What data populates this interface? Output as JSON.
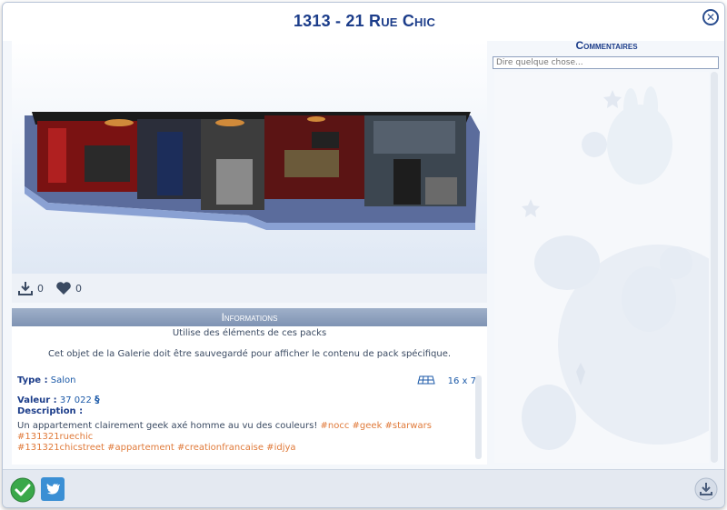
{
  "window": {
    "title": "1313 - 21 Rue Chic"
  },
  "stats": {
    "downloads": "0",
    "favorites": "0"
  },
  "info": {
    "header": "Informations",
    "packs_line": "Utilise des éléments de ces packs",
    "gallery_note": "Cet objet de la Galerie doit être sauvegardé pour afficher le contenu de pack spécifique.",
    "type_label": "Type :",
    "type_value": "Salon",
    "value_label": "Valeur :",
    "value_amount": "37 022",
    "currency_symbol": "§",
    "description_label": "Description :",
    "size": "16 x 7",
    "description_text": "Un appartement clairement geek axé homme au vu des couleurs!",
    "hashtags_line1": "#nocc #geek #starwars #131321ruechic",
    "hashtags_line2": "#131321chicstreet #appartement #creationfrancaise #idjya"
  },
  "comments": {
    "title": "Commentaires",
    "placeholder": "Dire quelque chose..."
  },
  "icons": {
    "close": "close-icon",
    "download": "download-icon",
    "heart": "heart-icon",
    "size": "grid-icon",
    "confirm": "checkmark-icon",
    "twitter": "twitter-icon",
    "save": "save-download-icon"
  },
  "colors": {
    "accent": "#1c3d8a",
    "hashtag": "#e07a3a",
    "info_header": "#8a9dbc",
    "confirm_green": "#3aa84a",
    "twitter_blue": "#3b8fd4"
  }
}
